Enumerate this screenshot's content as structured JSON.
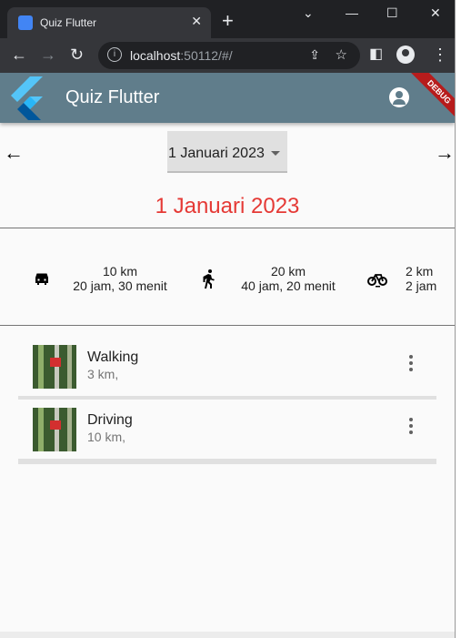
{
  "browser": {
    "tab_title": "Quiz Flutter",
    "tab_close": "✕",
    "new_tab": "+",
    "url_host": "localhost",
    "url_rest": ":50112/#/",
    "controls": {
      "dropdown": "⌄",
      "minimize": "—",
      "maximize": "☐",
      "close": "✕"
    }
  },
  "appbar": {
    "title": "Quiz Flutter",
    "debug_banner": "DEBUG",
    "color": "#607d8b"
  },
  "date_nav": {
    "prev_icon": "←",
    "next_icon": "→",
    "selected_date": "1 Januari 2023",
    "heading": "1 Januari 2023",
    "heading_color": "#e53935"
  },
  "summary": [
    {
      "icon": "car-icon",
      "distance": "10 km",
      "duration": "20 jam, 30 menit"
    },
    {
      "icon": "walk-icon",
      "distance": "20 km",
      "duration": "40 jam, 20 menit"
    },
    {
      "icon": "bike-icon",
      "distance": "2 km",
      "duration": "2 jam"
    }
  ],
  "activities": [
    {
      "title": "Walking",
      "subtitle": "3 km,"
    },
    {
      "title": "Driving",
      "subtitle": "10 km,"
    }
  ]
}
